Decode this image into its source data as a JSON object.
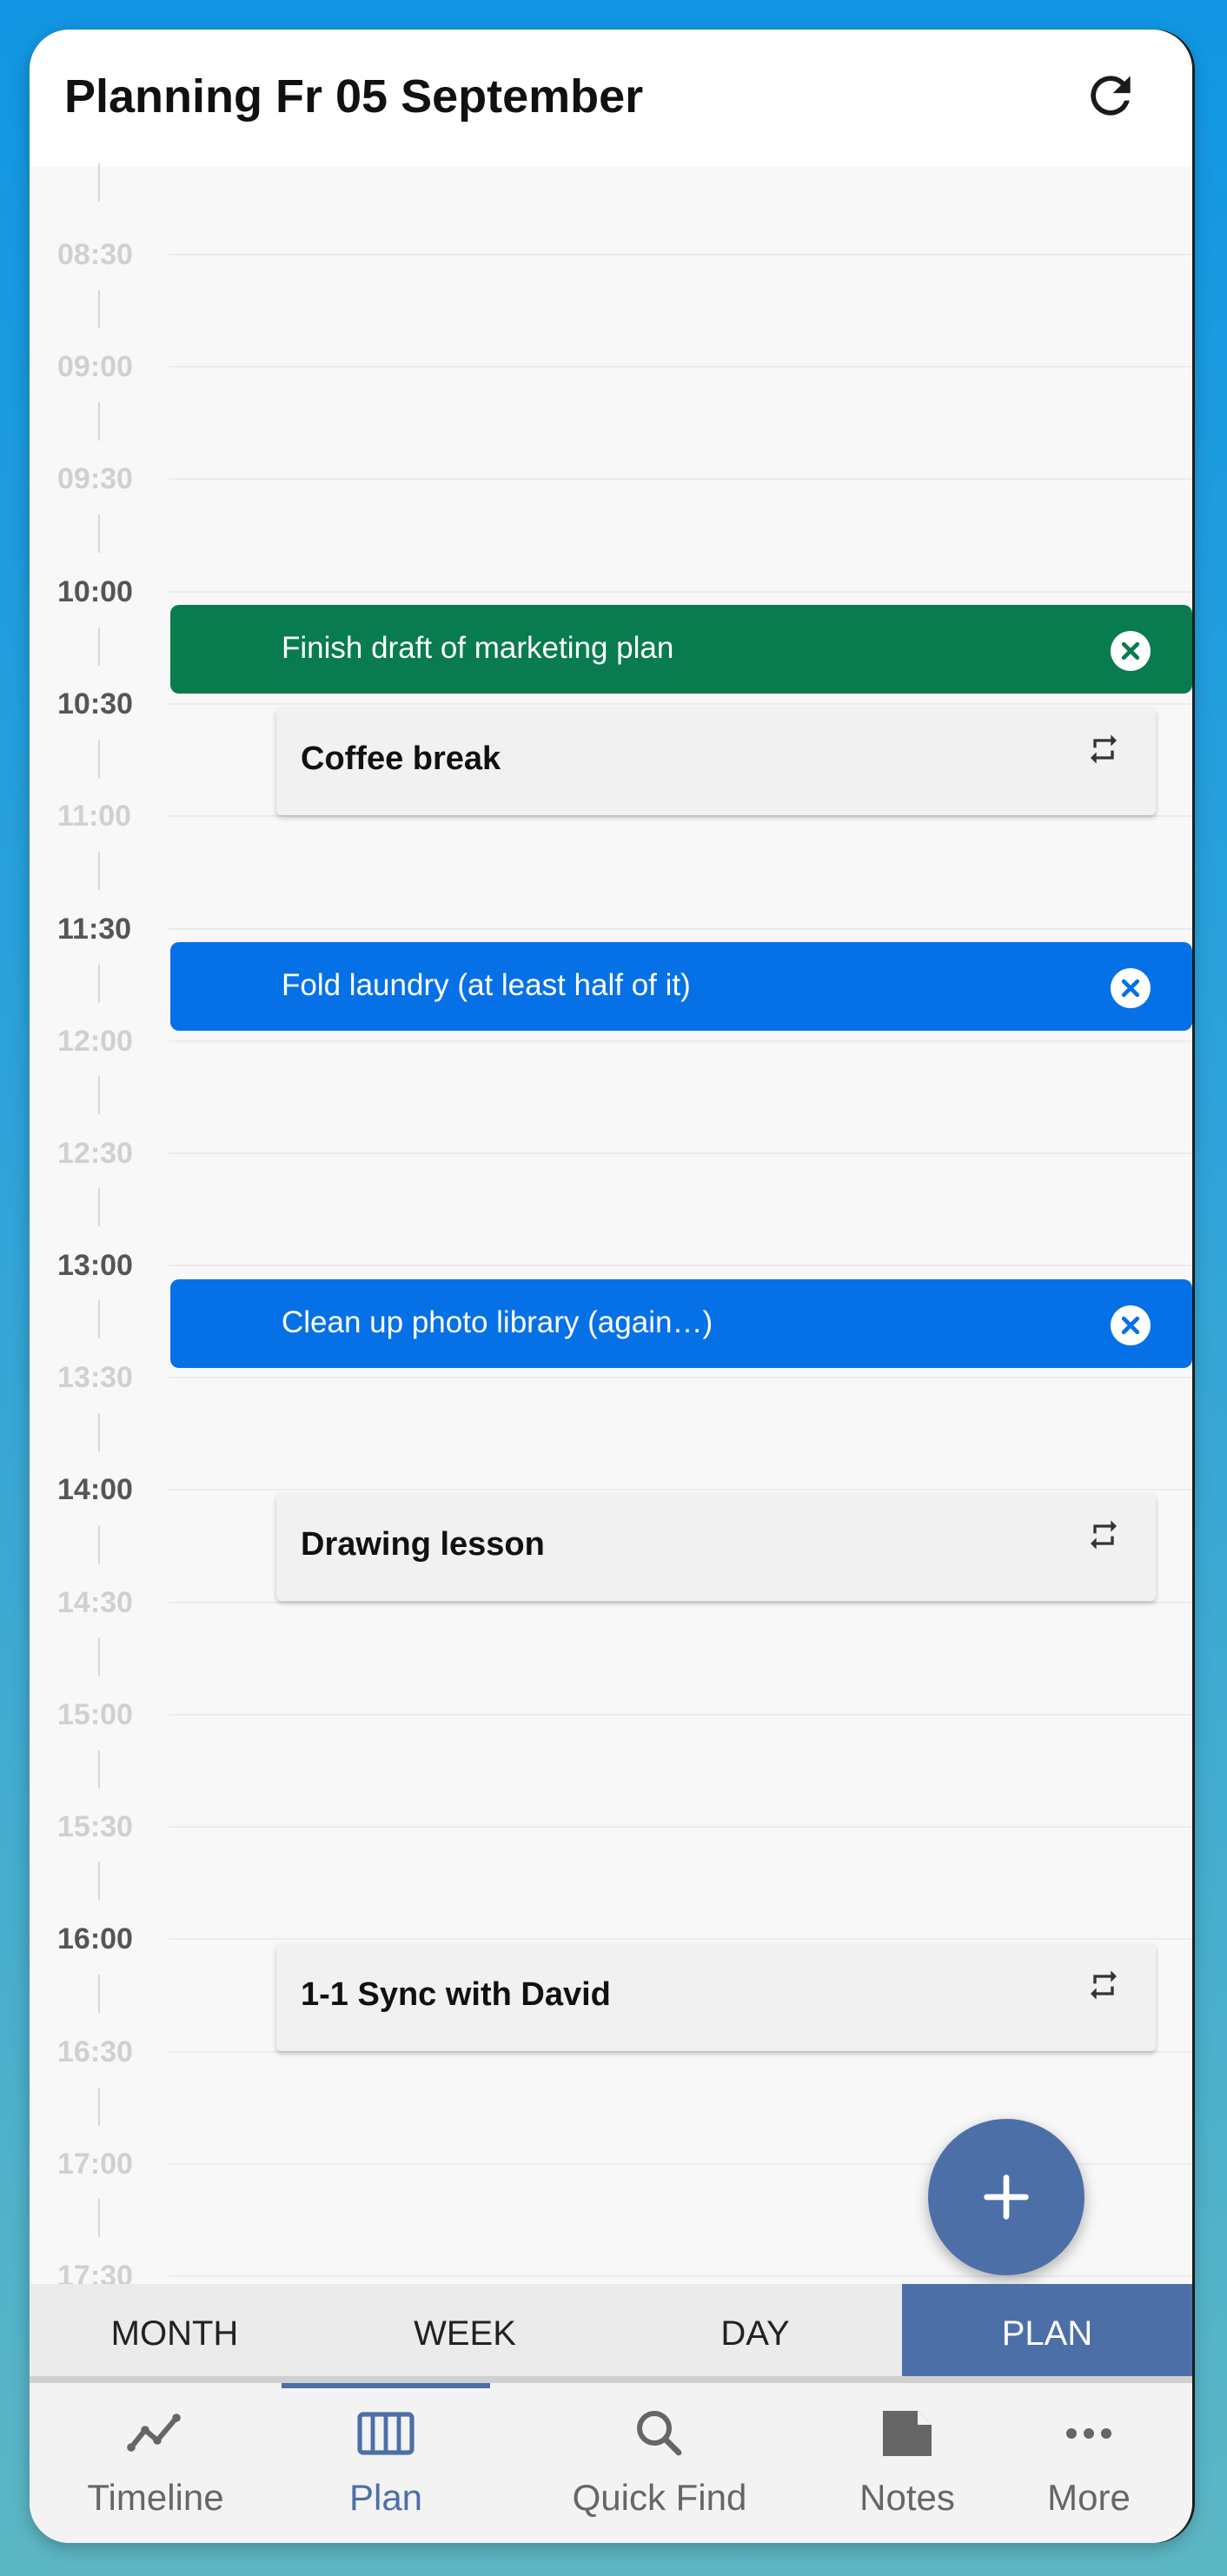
{
  "header": {
    "title": "Planning Fr 05 September",
    "refresh_icon": "refresh-icon"
  },
  "timeline": {
    "times": [
      "08:30",
      "09:00",
      "09:30",
      "10:00",
      "10:30",
      "11:00",
      "11:30",
      "12:00",
      "12:30",
      "13:00",
      "13:30",
      "14:00",
      "14:30",
      "15:00",
      "15:30",
      "16:00",
      "16:30",
      "17:00",
      "17:30"
    ]
  },
  "tasks": [
    {
      "label": "Finish draft of marketing plan",
      "color": "#087b4f"
    },
    {
      "label": "Fold laundry (at least half of it)",
      "color": "#0671e6"
    },
    {
      "label": "Clean up photo library (again…)",
      "color": "#0671e6"
    }
  ],
  "events": [
    {
      "label": "Coffee break",
      "icon": "repeat-icon"
    },
    {
      "label": "Drawing lesson",
      "icon": "repeat-icon"
    },
    {
      "label": "1-1 Sync with David",
      "icon": "repeat-icon"
    }
  ],
  "fab": {
    "icon": "plus-icon"
  },
  "view_tabs": [
    {
      "label": "MONTH"
    },
    {
      "label": "WEEK"
    },
    {
      "label": "DAY"
    },
    {
      "label": "PLAN",
      "active": true
    }
  ],
  "bottom_nav": [
    {
      "label": "Timeline",
      "icon": "timeline-icon"
    },
    {
      "label": "Plan",
      "icon": "plan-icon",
      "active": true
    },
    {
      "label": "Quick Find",
      "icon": "search-icon"
    },
    {
      "label": "Notes",
      "icon": "notes-icon"
    },
    {
      "label": "More",
      "icon": "more-icon"
    }
  ],
  "colors": {
    "accent": "#4c6fa7",
    "task_green": "#087b4f",
    "task_blue": "#0671e6"
  }
}
